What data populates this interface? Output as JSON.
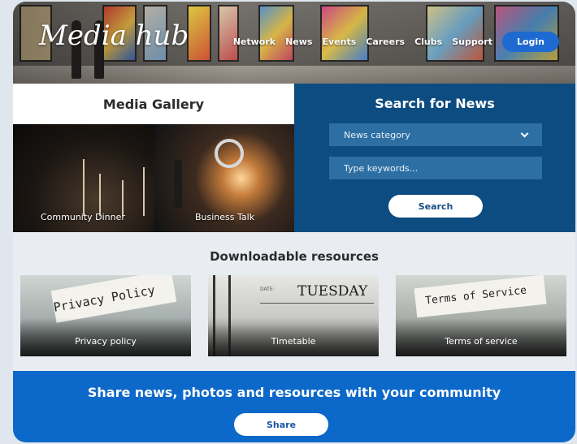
{
  "header": {
    "logo": "Media hub",
    "nav": [
      "Network",
      "News",
      "Events",
      "Careers",
      "Clubs",
      "Support"
    ],
    "login_label": "Login"
  },
  "gallery": {
    "title": "Media Gallery",
    "items": [
      {
        "caption": "Community Dinner"
      },
      {
        "caption": "Business Talk"
      }
    ]
  },
  "search": {
    "title": "Search for News",
    "category_value": "News category",
    "keywords_placeholder": "Type keywords...",
    "button_label": "Search"
  },
  "downloads": {
    "title": "Downloadable resources",
    "cards": [
      {
        "label": "Privacy policy",
        "image_text": "Privacy Policy"
      },
      {
        "label": "Timetable",
        "image_text": "TUESDAY",
        "image_subtext": "DATE:"
      },
      {
        "label": "Terms of service",
        "image_text": "Terms of Service"
      }
    ]
  },
  "share": {
    "title": "Share news, photos and resources with your community",
    "button_label": "Share"
  },
  "colors": {
    "accent_blue": "#0c68c9",
    "search_panel": "#0d4c80",
    "login_button": "#1f6ad0"
  }
}
